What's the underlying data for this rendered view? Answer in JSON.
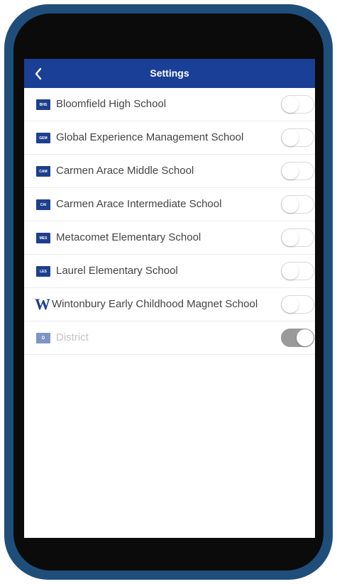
{
  "navbar": {
    "title": "Settings",
    "back_icon": "chevron-left-icon",
    "color": "#1a3f96"
  },
  "schools": [
    {
      "badge": "BHS",
      "label": "Bloomfield High School",
      "enabled": false
    },
    {
      "badge": "GEM",
      "label": "Global Experience Management School",
      "enabled": false
    },
    {
      "badge": "CAM",
      "label": "Carmen Arace Middle School",
      "enabled": false
    },
    {
      "badge": "CAI",
      "label": "Carmen Arace Intermediate School",
      "enabled": false
    },
    {
      "badge": "MES",
      "label": "Metacomet Elementary School",
      "enabled": false
    },
    {
      "badge": "LES",
      "label": "Laurel Elementary School",
      "enabled": false
    },
    {
      "badge": "W",
      "label": "Wintonbury Early Childhood Magnet School",
      "enabled": false
    },
    {
      "badge": "D",
      "label": "District",
      "enabled": true
    }
  ]
}
